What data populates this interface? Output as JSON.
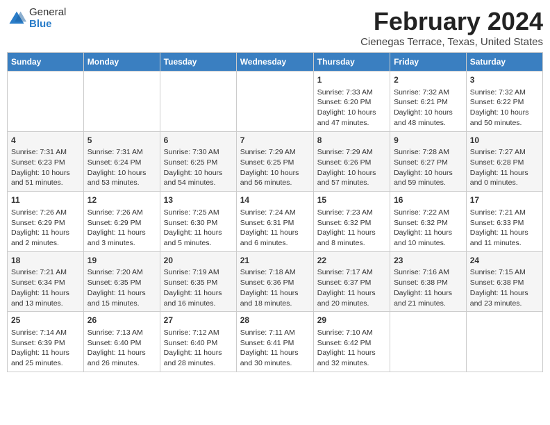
{
  "header": {
    "logo_general": "General",
    "logo_blue": "Blue",
    "title": "February 2024",
    "subtitle": "Cienegas Terrace, Texas, United States"
  },
  "days_of_week": [
    "Sunday",
    "Monday",
    "Tuesday",
    "Wednesday",
    "Thursday",
    "Friday",
    "Saturday"
  ],
  "weeks": [
    [
      {
        "day": "",
        "info": ""
      },
      {
        "day": "",
        "info": ""
      },
      {
        "day": "",
        "info": ""
      },
      {
        "day": "",
        "info": ""
      },
      {
        "day": "1",
        "info": "Sunrise: 7:33 AM\nSunset: 6:20 PM\nDaylight: 10 hours and 47 minutes."
      },
      {
        "day": "2",
        "info": "Sunrise: 7:32 AM\nSunset: 6:21 PM\nDaylight: 10 hours and 48 minutes."
      },
      {
        "day": "3",
        "info": "Sunrise: 7:32 AM\nSunset: 6:22 PM\nDaylight: 10 hours and 50 minutes."
      }
    ],
    [
      {
        "day": "4",
        "info": "Sunrise: 7:31 AM\nSunset: 6:23 PM\nDaylight: 10 hours and 51 minutes."
      },
      {
        "day": "5",
        "info": "Sunrise: 7:31 AM\nSunset: 6:24 PM\nDaylight: 10 hours and 53 minutes."
      },
      {
        "day": "6",
        "info": "Sunrise: 7:30 AM\nSunset: 6:25 PM\nDaylight: 10 hours and 54 minutes."
      },
      {
        "day": "7",
        "info": "Sunrise: 7:29 AM\nSunset: 6:25 PM\nDaylight: 10 hours and 56 minutes."
      },
      {
        "day": "8",
        "info": "Sunrise: 7:29 AM\nSunset: 6:26 PM\nDaylight: 10 hours and 57 minutes."
      },
      {
        "day": "9",
        "info": "Sunrise: 7:28 AM\nSunset: 6:27 PM\nDaylight: 10 hours and 59 minutes."
      },
      {
        "day": "10",
        "info": "Sunrise: 7:27 AM\nSunset: 6:28 PM\nDaylight: 11 hours and 0 minutes."
      }
    ],
    [
      {
        "day": "11",
        "info": "Sunrise: 7:26 AM\nSunset: 6:29 PM\nDaylight: 11 hours and 2 minutes."
      },
      {
        "day": "12",
        "info": "Sunrise: 7:26 AM\nSunset: 6:29 PM\nDaylight: 11 hours and 3 minutes."
      },
      {
        "day": "13",
        "info": "Sunrise: 7:25 AM\nSunset: 6:30 PM\nDaylight: 11 hours and 5 minutes."
      },
      {
        "day": "14",
        "info": "Sunrise: 7:24 AM\nSunset: 6:31 PM\nDaylight: 11 hours and 6 minutes."
      },
      {
        "day": "15",
        "info": "Sunrise: 7:23 AM\nSunset: 6:32 PM\nDaylight: 11 hours and 8 minutes."
      },
      {
        "day": "16",
        "info": "Sunrise: 7:22 AM\nSunset: 6:32 PM\nDaylight: 11 hours and 10 minutes."
      },
      {
        "day": "17",
        "info": "Sunrise: 7:21 AM\nSunset: 6:33 PM\nDaylight: 11 hours and 11 minutes."
      }
    ],
    [
      {
        "day": "18",
        "info": "Sunrise: 7:21 AM\nSunset: 6:34 PM\nDaylight: 11 hours and 13 minutes."
      },
      {
        "day": "19",
        "info": "Sunrise: 7:20 AM\nSunset: 6:35 PM\nDaylight: 11 hours and 15 minutes."
      },
      {
        "day": "20",
        "info": "Sunrise: 7:19 AM\nSunset: 6:35 PM\nDaylight: 11 hours and 16 minutes."
      },
      {
        "day": "21",
        "info": "Sunrise: 7:18 AM\nSunset: 6:36 PM\nDaylight: 11 hours and 18 minutes."
      },
      {
        "day": "22",
        "info": "Sunrise: 7:17 AM\nSunset: 6:37 PM\nDaylight: 11 hours and 20 minutes."
      },
      {
        "day": "23",
        "info": "Sunrise: 7:16 AM\nSunset: 6:38 PM\nDaylight: 11 hours and 21 minutes."
      },
      {
        "day": "24",
        "info": "Sunrise: 7:15 AM\nSunset: 6:38 PM\nDaylight: 11 hours and 23 minutes."
      }
    ],
    [
      {
        "day": "25",
        "info": "Sunrise: 7:14 AM\nSunset: 6:39 PM\nDaylight: 11 hours and 25 minutes."
      },
      {
        "day": "26",
        "info": "Sunrise: 7:13 AM\nSunset: 6:40 PM\nDaylight: 11 hours and 26 minutes."
      },
      {
        "day": "27",
        "info": "Sunrise: 7:12 AM\nSunset: 6:40 PM\nDaylight: 11 hours and 28 minutes."
      },
      {
        "day": "28",
        "info": "Sunrise: 7:11 AM\nSunset: 6:41 PM\nDaylight: 11 hours and 30 minutes."
      },
      {
        "day": "29",
        "info": "Sunrise: 7:10 AM\nSunset: 6:42 PM\nDaylight: 11 hours and 32 minutes."
      },
      {
        "day": "",
        "info": ""
      },
      {
        "day": "",
        "info": ""
      }
    ]
  ]
}
